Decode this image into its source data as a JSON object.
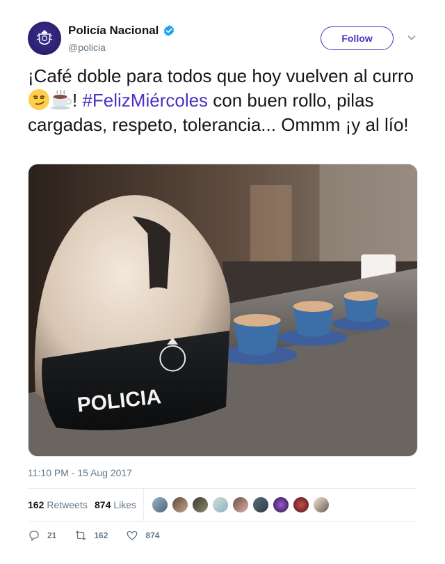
{
  "account": {
    "display_name": "Policía Nacional",
    "handle": "@policia",
    "verified_icon": "verified-badge-icon",
    "follow_label": "Follow"
  },
  "tweet": {
    "text_part1": "¡Café doble para todos que hoy vuelven al curro",
    "text_part2": "! ",
    "hashtag": "#FelizMiércoles",
    "text_part3": " con buen rollo, pilas cargadas, respeto, tolerancia... Ommm ¡y al lío!",
    "emojis": [
      "smirking-face-icon",
      "hot-beverage-icon"
    ],
    "media_text": "POLICIA",
    "timestamp": "11:10 PM - 15 Aug 2017"
  },
  "stats": {
    "retweets_count": "162",
    "retweets_label": "Retweets",
    "likes_count": "874",
    "likes_label": "Likes"
  },
  "actions": {
    "reply_count": "21",
    "retweet_count": "162",
    "like_count": "874"
  },
  "colors": {
    "accent": "#4e2fc4",
    "verified": "#1da1f2",
    "muted": "#657786"
  }
}
